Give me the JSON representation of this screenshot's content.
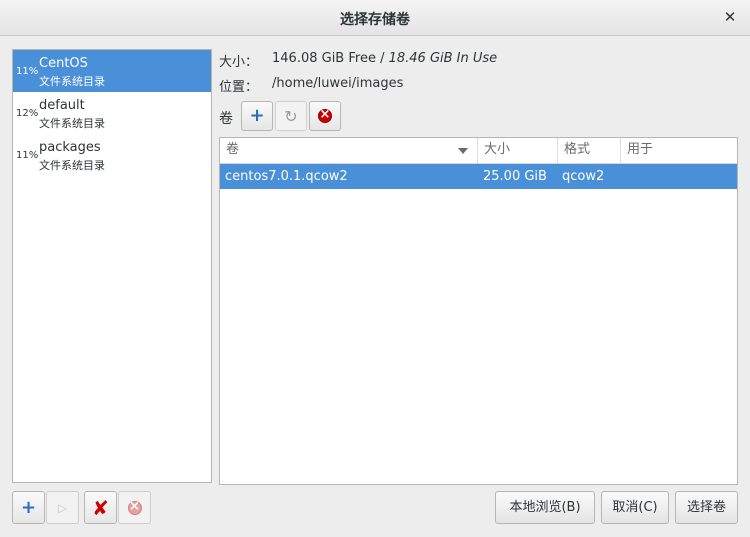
{
  "window": {
    "title": "选择存储卷"
  },
  "pools": [
    {
      "percent": "11%",
      "name": "CentOS",
      "type": "文件系统目录",
      "selected": true
    },
    {
      "percent": "12%",
      "name": "default",
      "type": "文件系统目录",
      "selected": false
    },
    {
      "percent": "11%",
      "name": "packages",
      "type": "文件系统目录",
      "selected": false
    }
  ],
  "info": {
    "size_label": "大小：",
    "size_free": "146.08 GiB Free / ",
    "size_used": "18.46 GiB In Use",
    "location_label": "位置：",
    "location_value": "/home/luwei/images"
  },
  "volumes_toolbar": {
    "label": "卷"
  },
  "volume_table": {
    "columns": [
      "卷",
      "大小",
      "格式",
      "用于"
    ],
    "rows": [
      {
        "name": "centos7.0.1.qcow2",
        "size": "25.00 GiB",
        "format": "qcow2",
        "used_by": ""
      }
    ]
  },
  "dialog_buttons": {
    "browse_local": "本地浏览(B)",
    "cancel": "取消(C)",
    "choose_volume": "选择卷"
  },
  "colors": {
    "selection": "#4a90d9",
    "stop": "#cc0000",
    "add": "#2f6dbf"
  },
  "icons": [
    "close-icon",
    "add-icon",
    "refresh-icon",
    "stop-icon",
    "play-icon",
    "delete-icon"
  ]
}
